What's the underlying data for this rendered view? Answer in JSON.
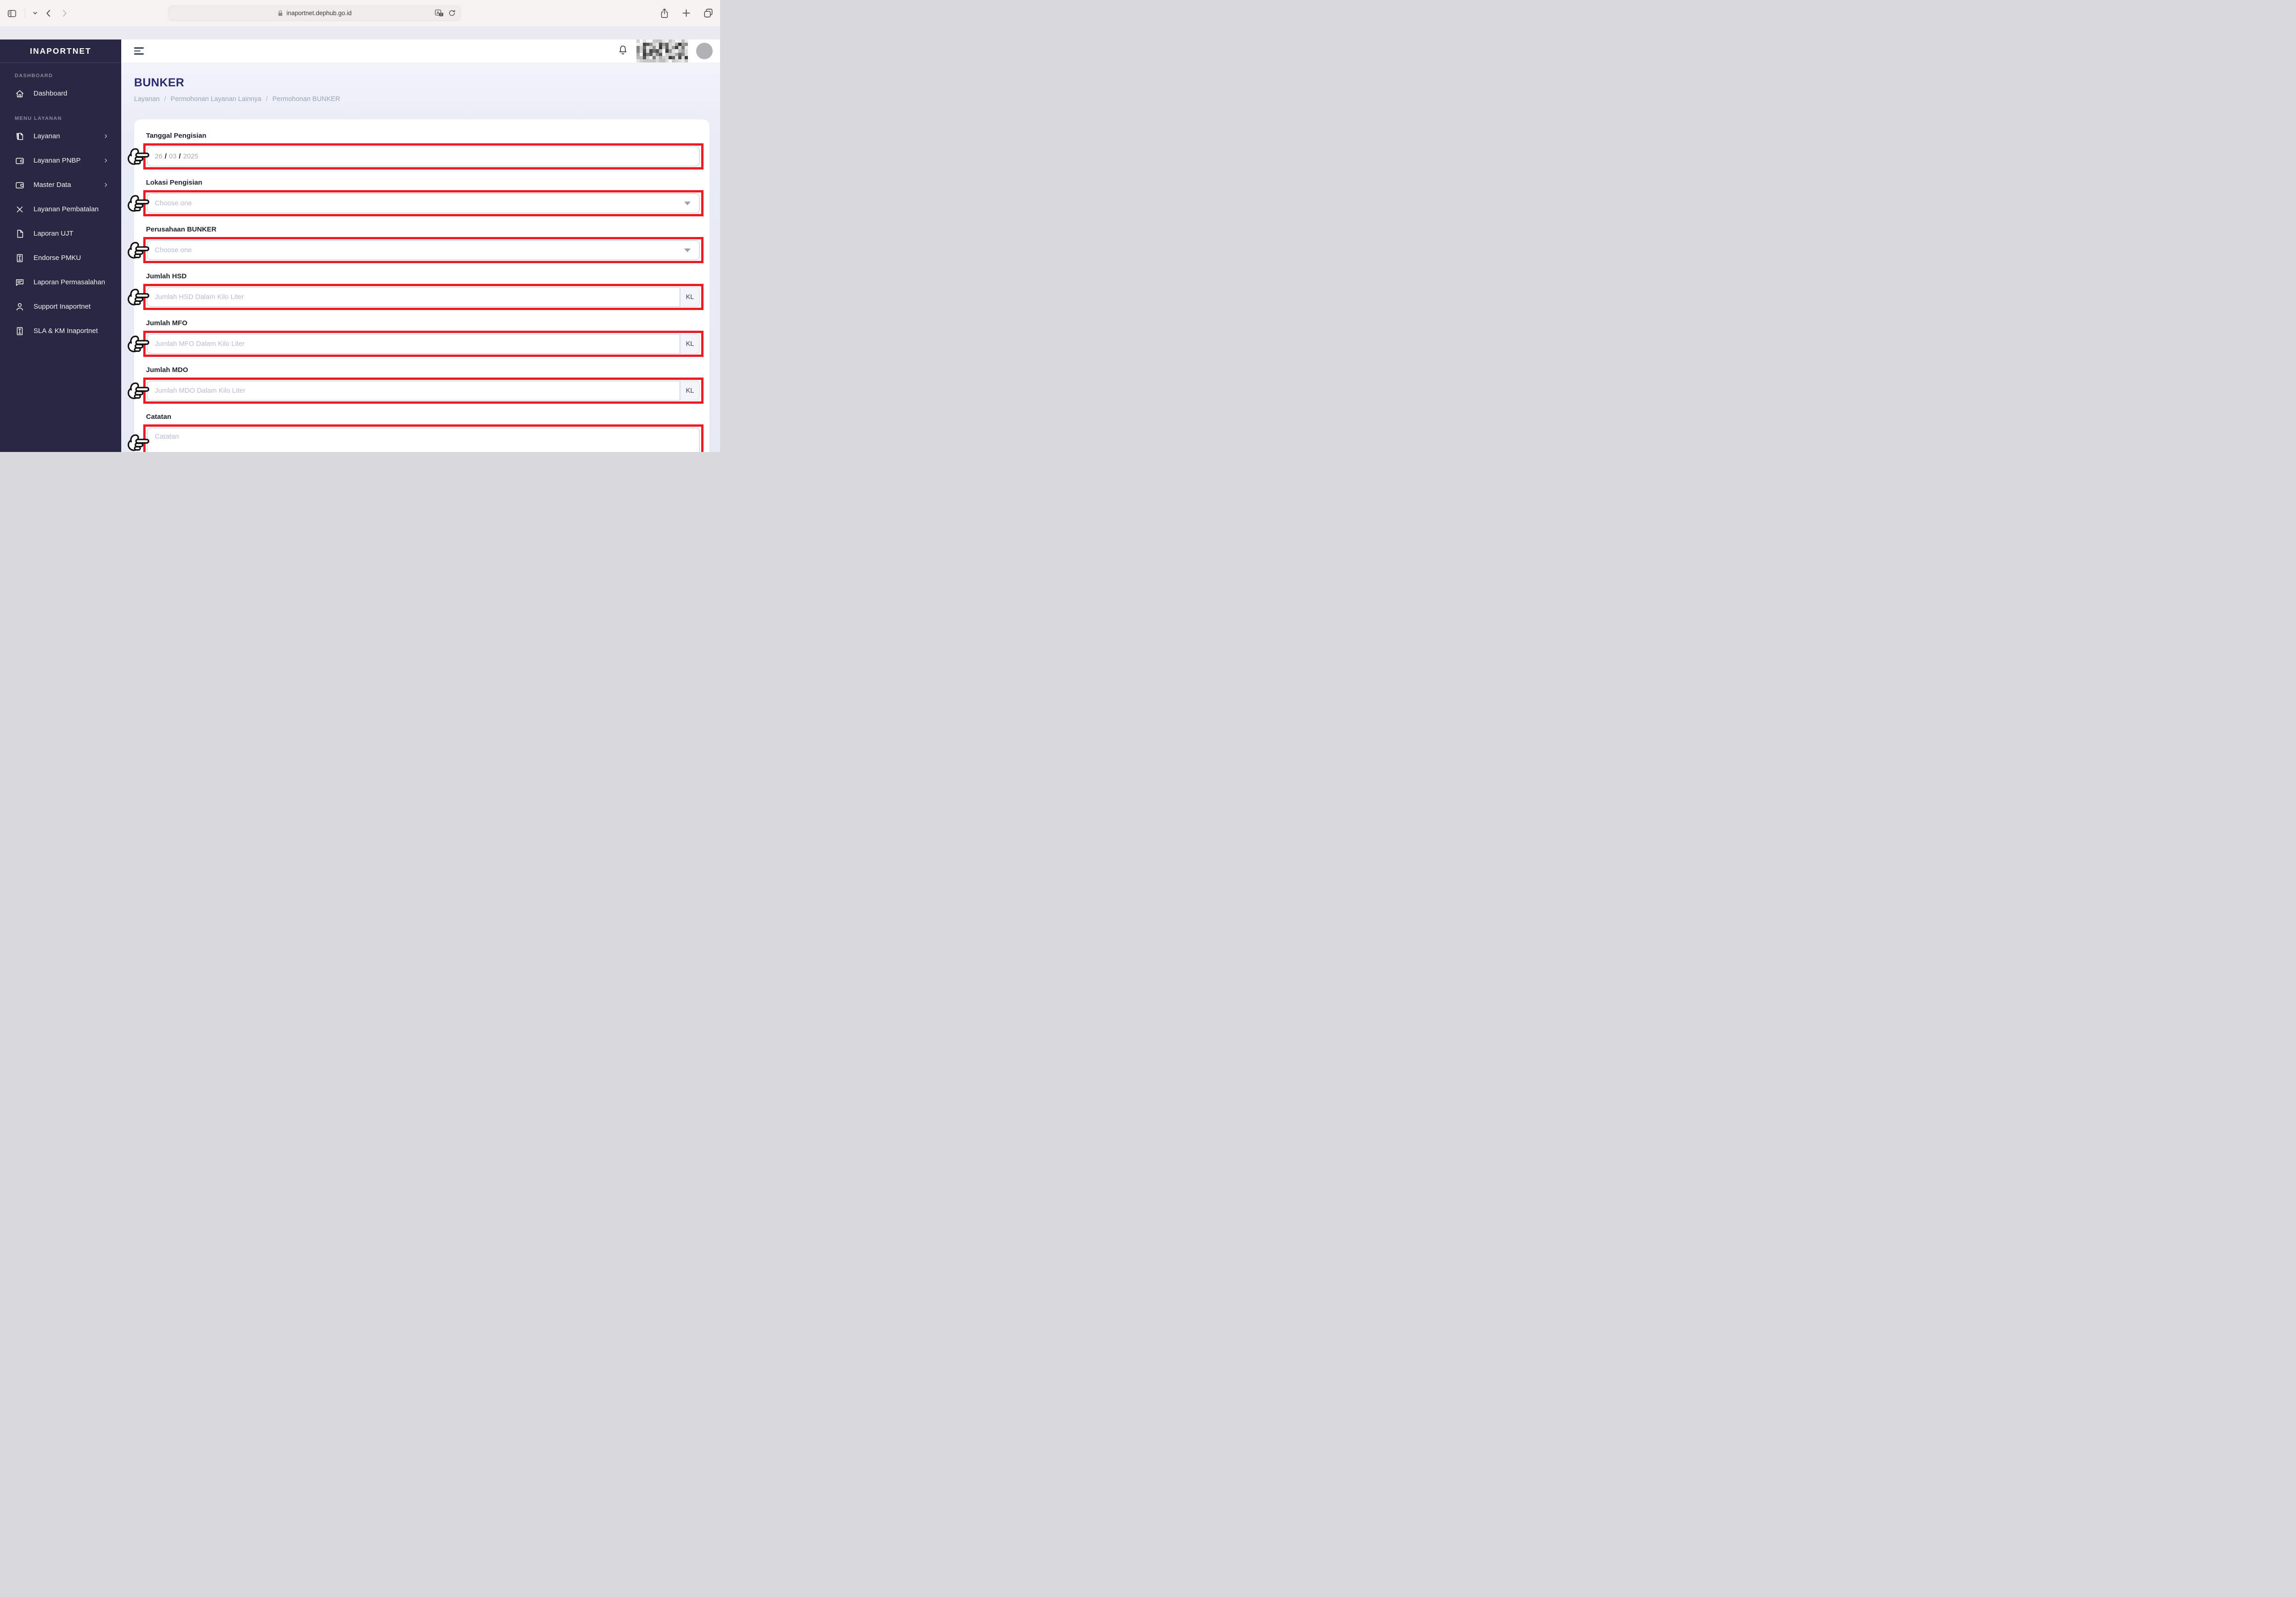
{
  "browser": {
    "url": "inaportnet.dephub.go.id",
    "left_icons": [
      "sidebar-toggle-icon",
      "tab-chevron-down-icon",
      "back-icon",
      "forward-icon"
    ],
    "urlbar_icons": [
      "lock-icon",
      "translate-icon",
      "reload-icon"
    ],
    "right_icons": [
      "share-icon",
      "new-tab-icon",
      "tabs-overview-icon"
    ]
  },
  "header": {
    "icons": [
      "menu-toggle-icon",
      "notification-bell-icon"
    ],
    "user_name_censored": true
  },
  "sidebar": {
    "logo": "INAPORTNET",
    "sections": [
      {
        "label": "DASHBOARD",
        "items": [
          {
            "label": "Dashboard",
            "icon": "home-icon",
            "chevron": false
          }
        ]
      },
      {
        "label": "MENU LAYANAN",
        "items": [
          {
            "label": "Layanan",
            "icon": "document-pen-icon",
            "chevron": true
          },
          {
            "label": "Layanan PNBP",
            "icon": "wallet-icon",
            "chevron": true
          },
          {
            "label": "Master Data",
            "icon": "wallet-icon",
            "chevron": true
          },
          {
            "label": "Layanan Pembatalan",
            "icon": "x-icon",
            "chevron": false
          },
          {
            "label": "Laporan UJT",
            "icon": "file-icon",
            "chevron": false
          },
          {
            "label": "Endorse PMKU",
            "icon": "stamp-box-icon",
            "chevron": false
          },
          {
            "label": "Laporan Permasalahan",
            "icon": "chat-icon",
            "chevron": false
          },
          {
            "label": "Support Inaportnet",
            "icon": "person-icon",
            "chevron": false
          },
          {
            "label": "SLA & KM Inaportnet",
            "icon": "stamp-box-icon",
            "chevron": false
          }
        ]
      }
    ]
  },
  "page": {
    "title": "BUNKER",
    "breadcrumb": [
      "Layanan",
      "Permohonan Layanan Lainnya",
      "Permohonan BUNKER"
    ],
    "breadcrumb_separator": "/"
  },
  "form": {
    "fields": [
      {
        "name": "tanggal-pengisian",
        "label": "Tanggal Pengisian",
        "type": "date",
        "value_day": "26",
        "value_month": "03",
        "value_year": "2025",
        "separator": "/"
      },
      {
        "name": "lokasi-pengisian",
        "label": "Lokasi Pengisian",
        "type": "select",
        "placeholder": "Choose one"
      },
      {
        "name": "perusahaan-bunker",
        "label": "Perusahaan BUNKER",
        "type": "select",
        "placeholder": "Choose one"
      },
      {
        "name": "jumlah-hsd",
        "label": "Jumlah HSD",
        "type": "text",
        "placeholder": "Jumlah HSD Dalam Kilo Liter",
        "addon": "KL"
      },
      {
        "name": "jumlah-mfo",
        "label": "Jumlah MFO",
        "type": "text",
        "placeholder": "Jumlah MFO Dalam Kilo Liter",
        "addon": "KL"
      },
      {
        "name": "jumlah-mdo",
        "label": "Jumlah MDO",
        "type": "text",
        "placeholder": "Jumlah MDO Dalam Kilo Liter",
        "addon": "KL"
      },
      {
        "name": "catatan",
        "label": "Catatan",
        "type": "textarea",
        "placeholder": "Catatan"
      }
    ]
  },
  "colors": {
    "highlight_red": "#ed1c24",
    "sidebar_bg": "#2a2743",
    "title_color": "#2b2a70",
    "input_border": "#c3c5d6",
    "placeholder": "#b6bcd2"
  }
}
